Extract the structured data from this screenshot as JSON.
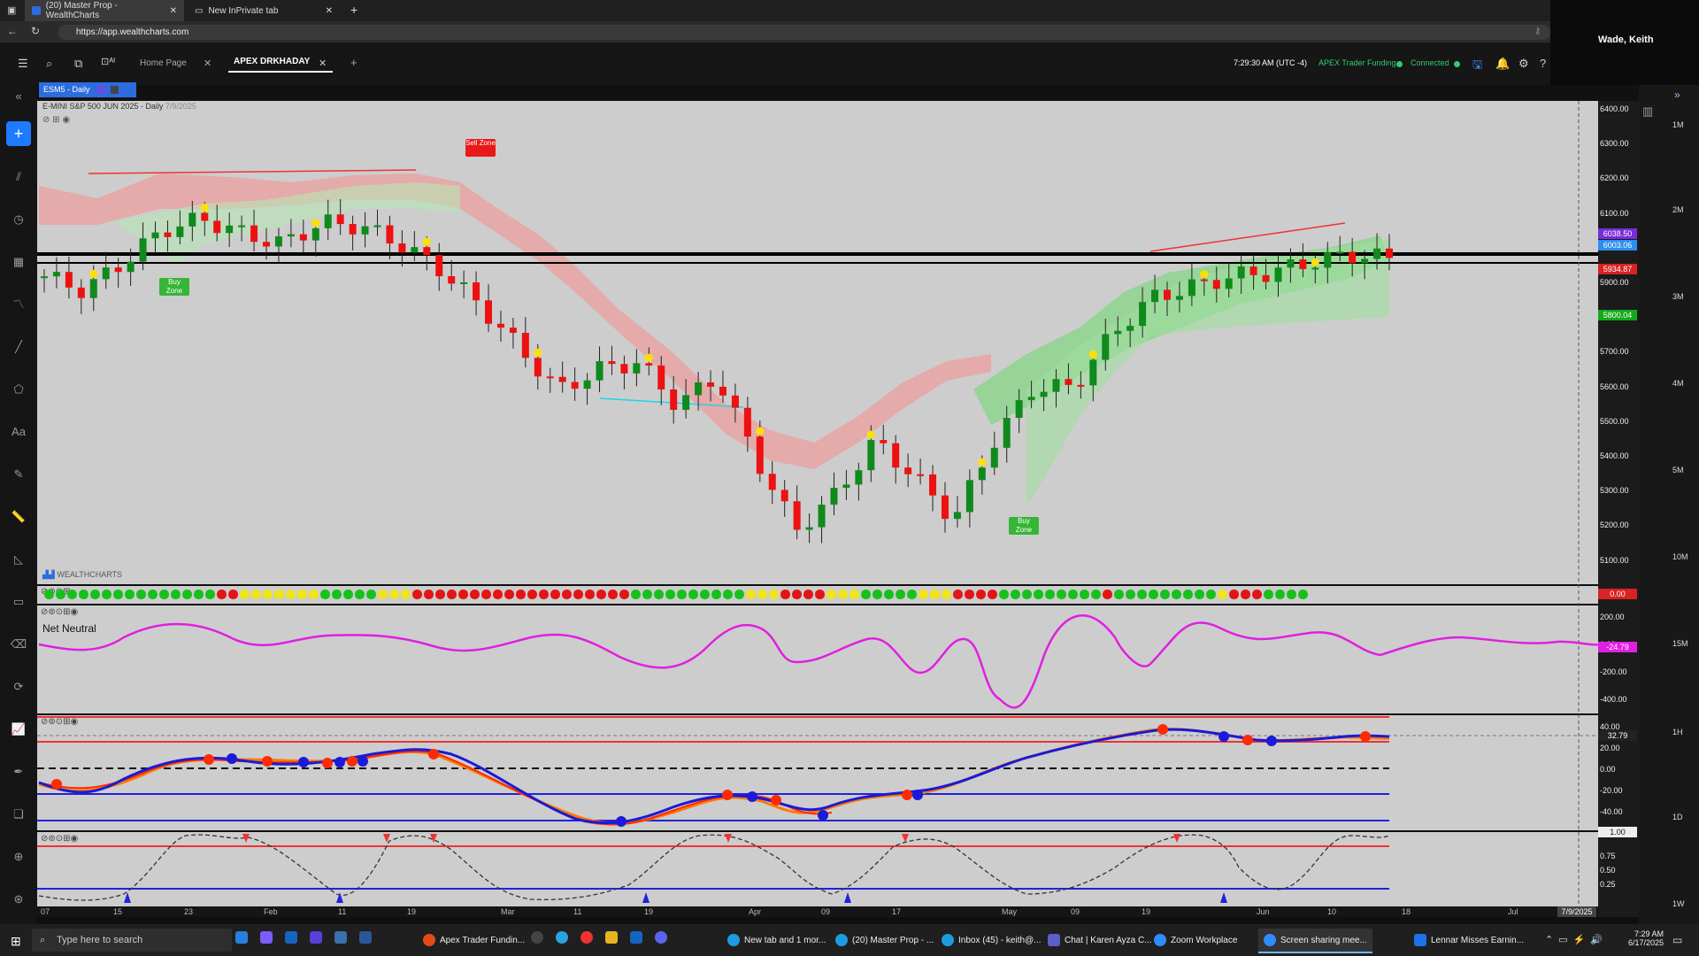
{
  "browser": {
    "tabs": [
      {
        "label": "(20) Master Prop - WealthCharts"
      },
      {
        "label": "New InPrivate tab"
      }
    ],
    "url": "https://app.wealthcharts.com"
  },
  "window": {
    "user": "Wade, Keith"
  },
  "app": {
    "tabs": [
      {
        "label": "Home Page"
      },
      {
        "label": "APEX DRKHADAY"
      }
    ],
    "clock": "7:29:30 AM  (UTC -4)",
    "account": "APEX Trader Funding",
    "connection": "Connected",
    "colors": {
      "accent": "#1e7bff",
      "connected": "#2ecc71",
      "bull": "#0f8a1b",
      "bear": "#ee1111"
    }
  },
  "chart": {
    "symbol_tag": "ESM5 - Daily",
    "title": "E-MINI S&P 500 JUN 2025 - Daily",
    "date_tag": "7/9/2025",
    "zones": {
      "sell": "Sell Zone",
      "buy": "Buy Zone"
    },
    "watermark": "WEALTHCHARTS",
    "net_label": "Net Neutral",
    "price_axis": [
      "6400.00",
      "6300.00",
      "6200.00",
      "6100.00",
      "6000.00",
      "5900.00",
      "5800.00",
      "5700.00",
      "5600.00",
      "5500.00",
      "5400.00",
      "5300.00",
      "5200.00",
      "5100.00"
    ],
    "badges": {
      "p1": "6038.50",
      "p2": "6003.06",
      "p3": "5934.87",
      "p4": "5800.04",
      "dots": "0.00",
      "net": "-24.79",
      "osc": "32.79",
      "bot": "1.00"
    },
    "net_axis": [
      "200.00",
      "0.00",
      "-200.00",
      "-400.00"
    ],
    "osc_axis": [
      "40.00",
      "20.00",
      "0.00",
      "-20.00",
      "-40.00"
    ],
    "bot_axis": [
      "0.75",
      "0.50",
      "0.25"
    ],
    "time_axis": [
      "07",
      "15",
      "23",
      "Feb",
      "11",
      "19",
      "Mar",
      "11",
      "19",
      "Apr",
      "09",
      "17",
      "May",
      "09",
      "19",
      "Jun",
      "10",
      "18",
      "Jul"
    ],
    "cursor_date": "7/9/2025",
    "volume_labels": [
      "1M",
      "2M",
      "3M",
      "4M",
      "5M",
      "10M",
      "15M",
      "1H",
      "1D",
      "1W"
    ],
    "chart_data": {
      "type": "candlestick",
      "series": [
        {
          "name": "price",
          "note": "daily candles Jan–Jun 2025, approx closes",
          "values": [
            5960,
            5920,
            6000,
            6090,
            6120,
            6080,
            6050,
            6110,
            6100,
            6050,
            5980,
            5880,
            5760,
            5640,
            5700,
            5720,
            5600,
            5680,
            5450,
            5250,
            5350,
            5500,
            5400,
            5280,
            5500,
            5650,
            5650,
            5800,
            5900,
            5930,
            5960,
            5970,
            6000,
            6020,
            6010
          ]
        }
      ]
    }
  },
  "taskbar": {
    "search": "Type here to search",
    "apps": [
      "Apex Trader Fundin...",
      "New tab and 1 mor...",
      "(20) Master Prop - ...",
      "Inbox (45) - keith@...",
      "Chat | Karen Ayza C...",
      "Zoom Workplace",
      "Screen sharing mee..."
    ],
    "news": "Lennar Misses Earnin...",
    "time": "7:29 AM",
    "date": "6/17/2025"
  }
}
